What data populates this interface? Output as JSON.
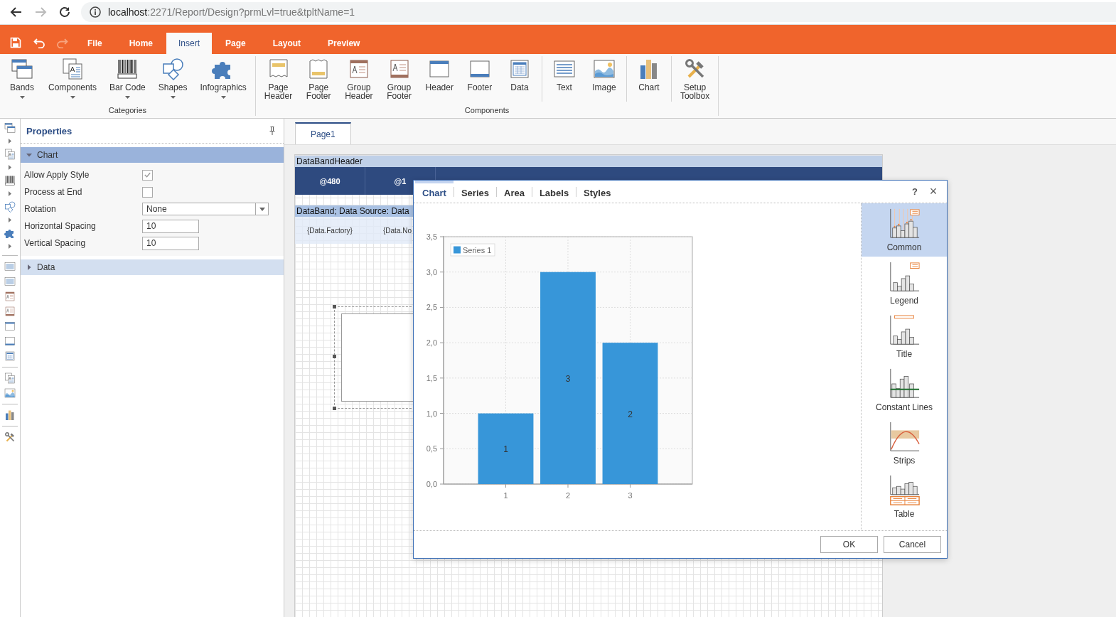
{
  "browser": {
    "nav": [
      {
        "kind": "back",
        "disabled": false
      },
      {
        "kind": "forward",
        "disabled": true
      },
      {
        "kind": "reload",
        "disabled": false
      }
    ],
    "address": {
      "host": "localhost",
      "path": ":2271/Report/Design?prmLvl=true&tpltName=1"
    }
  },
  "quick_actions": [
    {
      "kind": "save",
      "disabled": false
    },
    {
      "kind": "undo",
      "disabled": false
    },
    {
      "kind": "redo",
      "disabled": true
    }
  ],
  "menu_tabs": [
    {
      "label": "File",
      "selected": false
    },
    {
      "label": "Home",
      "selected": false
    },
    {
      "label": "Insert",
      "selected": true
    },
    {
      "label": "Page",
      "selected": false
    },
    {
      "label": "Layout",
      "selected": false
    },
    {
      "label": "Preview",
      "selected": false
    }
  ],
  "ribbon": {
    "groups": [
      {
        "label": "Categories",
        "sections": [
          [
            {
              "lines": [
                "Bands"
              ],
              "dropdown": true
            },
            {
              "lines": [
                "Components"
              ],
              "dropdown": true
            },
            {
              "lines": [
                "Bar Code"
              ],
              "dropdown": true
            },
            {
              "lines": [
                "Shapes"
              ],
              "dropdown": true
            },
            {
              "lines": [
                "Infographics"
              ],
              "dropdown": true
            }
          ]
        ]
      },
      {
        "label": "Components",
        "sections": [
          [
            {
              "lines": [
                "Page",
                "Header"
              ],
              "dropdown": false
            },
            {
              "lines": [
                "Page",
                "Footer"
              ],
              "dropdown": false
            },
            {
              "lines": [
                "Group",
                "Header"
              ],
              "dropdown": false
            },
            {
              "lines": [
                "Group",
                "Footer"
              ],
              "dropdown": false
            },
            {
              "lines": [
                "Header"
              ],
              "dropdown": false
            },
            {
              "lines": [
                "Footer"
              ],
              "dropdown": false
            },
            {
              "lines": [
                "Data"
              ],
              "dropdown": false
            }
          ],
          [
            {
              "lines": [
                "Text"
              ],
              "dropdown": false
            },
            {
              "lines": [
                "Image"
              ],
              "dropdown": false
            }
          ],
          [
            {
              "lines": [
                "Chart"
              ],
              "dropdown": false
            }
          ],
          [
            {
              "lines": [
                "Setup",
                "Toolbox"
              ],
              "dropdown": false
            }
          ]
        ]
      }
    ]
  },
  "properties": {
    "title": "Properties",
    "sections": [
      {
        "label": "Chart",
        "expanded": true,
        "rows": [
          {
            "label": "Allow Apply Style",
            "kind": "checkbox",
            "checked": true
          },
          {
            "label": "Process at End",
            "kind": "checkbox",
            "checked": false
          },
          {
            "label": "Rotation",
            "kind": "select",
            "value": "None"
          },
          {
            "label": "Horizontal Spacing",
            "kind": "input",
            "value": "10"
          },
          {
            "label": "Vertical Spacing",
            "kind": "input",
            "value": "10"
          }
        ]
      },
      {
        "label": "Data",
        "expanded": false
      }
    ]
  },
  "report": {
    "tabs": [
      {
        "label": "Page1",
        "selected": true
      }
    ],
    "header_band": {
      "label": "DataBandHeader",
      "cells": [
        "@480",
        "@1"
      ]
    },
    "data_band": {
      "label": "DataBand; Data Source: Data",
      "cells": [
        "{Data.Factory}",
        "{Data.No"
      ]
    }
  },
  "dialog": {
    "tabs": [
      {
        "label": "Chart",
        "selected": true
      },
      {
        "label": "Series",
        "selected": false
      },
      {
        "label": "Area",
        "selected": false
      },
      {
        "label": "Labels",
        "selected": false
      },
      {
        "label": "Styles",
        "selected": false
      }
    ],
    "help": "?",
    "close": "×",
    "chart_data": {
      "type": "bar",
      "categories": [
        "1",
        "2",
        "3"
      ],
      "series": [
        {
          "name": "Series 1",
          "color": "#3796d9",
          "values": [
            1,
            3,
            2
          ]
        }
      ],
      "ylim": [
        0,
        3.5
      ],
      "yticks": [
        {
          "value": 0,
          "label": "0,0"
        },
        {
          "value": 0.5,
          "label": "0,5"
        },
        {
          "value": 1,
          "label": "1,0"
        },
        {
          "value": 1.5,
          "label": "1,5"
        },
        {
          "value": 2,
          "label": "2,0"
        },
        {
          "value": 2.5,
          "label": "2,5"
        },
        {
          "value": 3,
          "label": "3,0"
        },
        {
          "value": 3.5,
          "label": "3,5"
        }
      ],
      "data_labels": true,
      "grid": true
    },
    "categories": [
      {
        "label": "Common",
        "selected": true
      },
      {
        "label": "Legend",
        "selected": false
      },
      {
        "label": "Title",
        "selected": false
      },
      {
        "label": "Constant Lines",
        "selected": false
      },
      {
        "label": "Strips",
        "selected": false
      },
      {
        "label": "Table",
        "selected": false
      }
    ],
    "buttons": [
      "OK",
      "Cancel"
    ]
  }
}
